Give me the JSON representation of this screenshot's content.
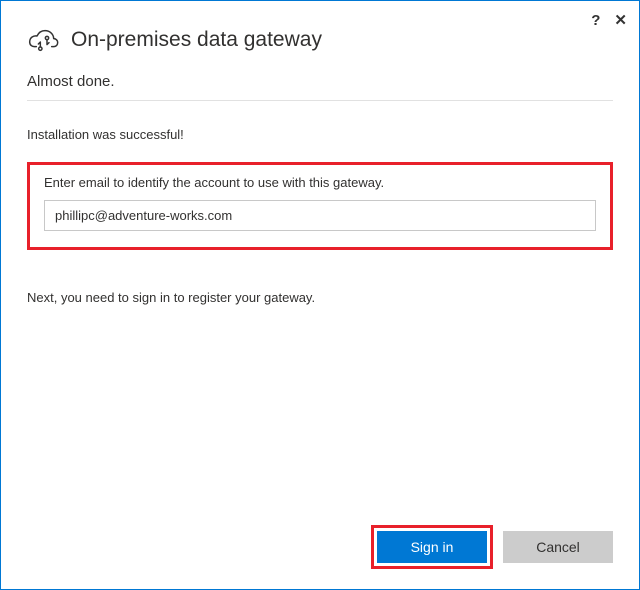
{
  "titlebar": {
    "help_symbol": "?",
    "close_symbol": "✕"
  },
  "header": {
    "title": "On-premises data gateway"
  },
  "body": {
    "subtitle": "Almost done.",
    "status": "Installation was successful!",
    "email_label": "Enter email to identify the account to use with this gateway.",
    "email_value": "phillipc@adventure-works.com",
    "next_instruction": "Next, you need to sign in to register your gateway."
  },
  "footer": {
    "sign_in_label": "Sign in",
    "cancel_label": "Cancel"
  }
}
